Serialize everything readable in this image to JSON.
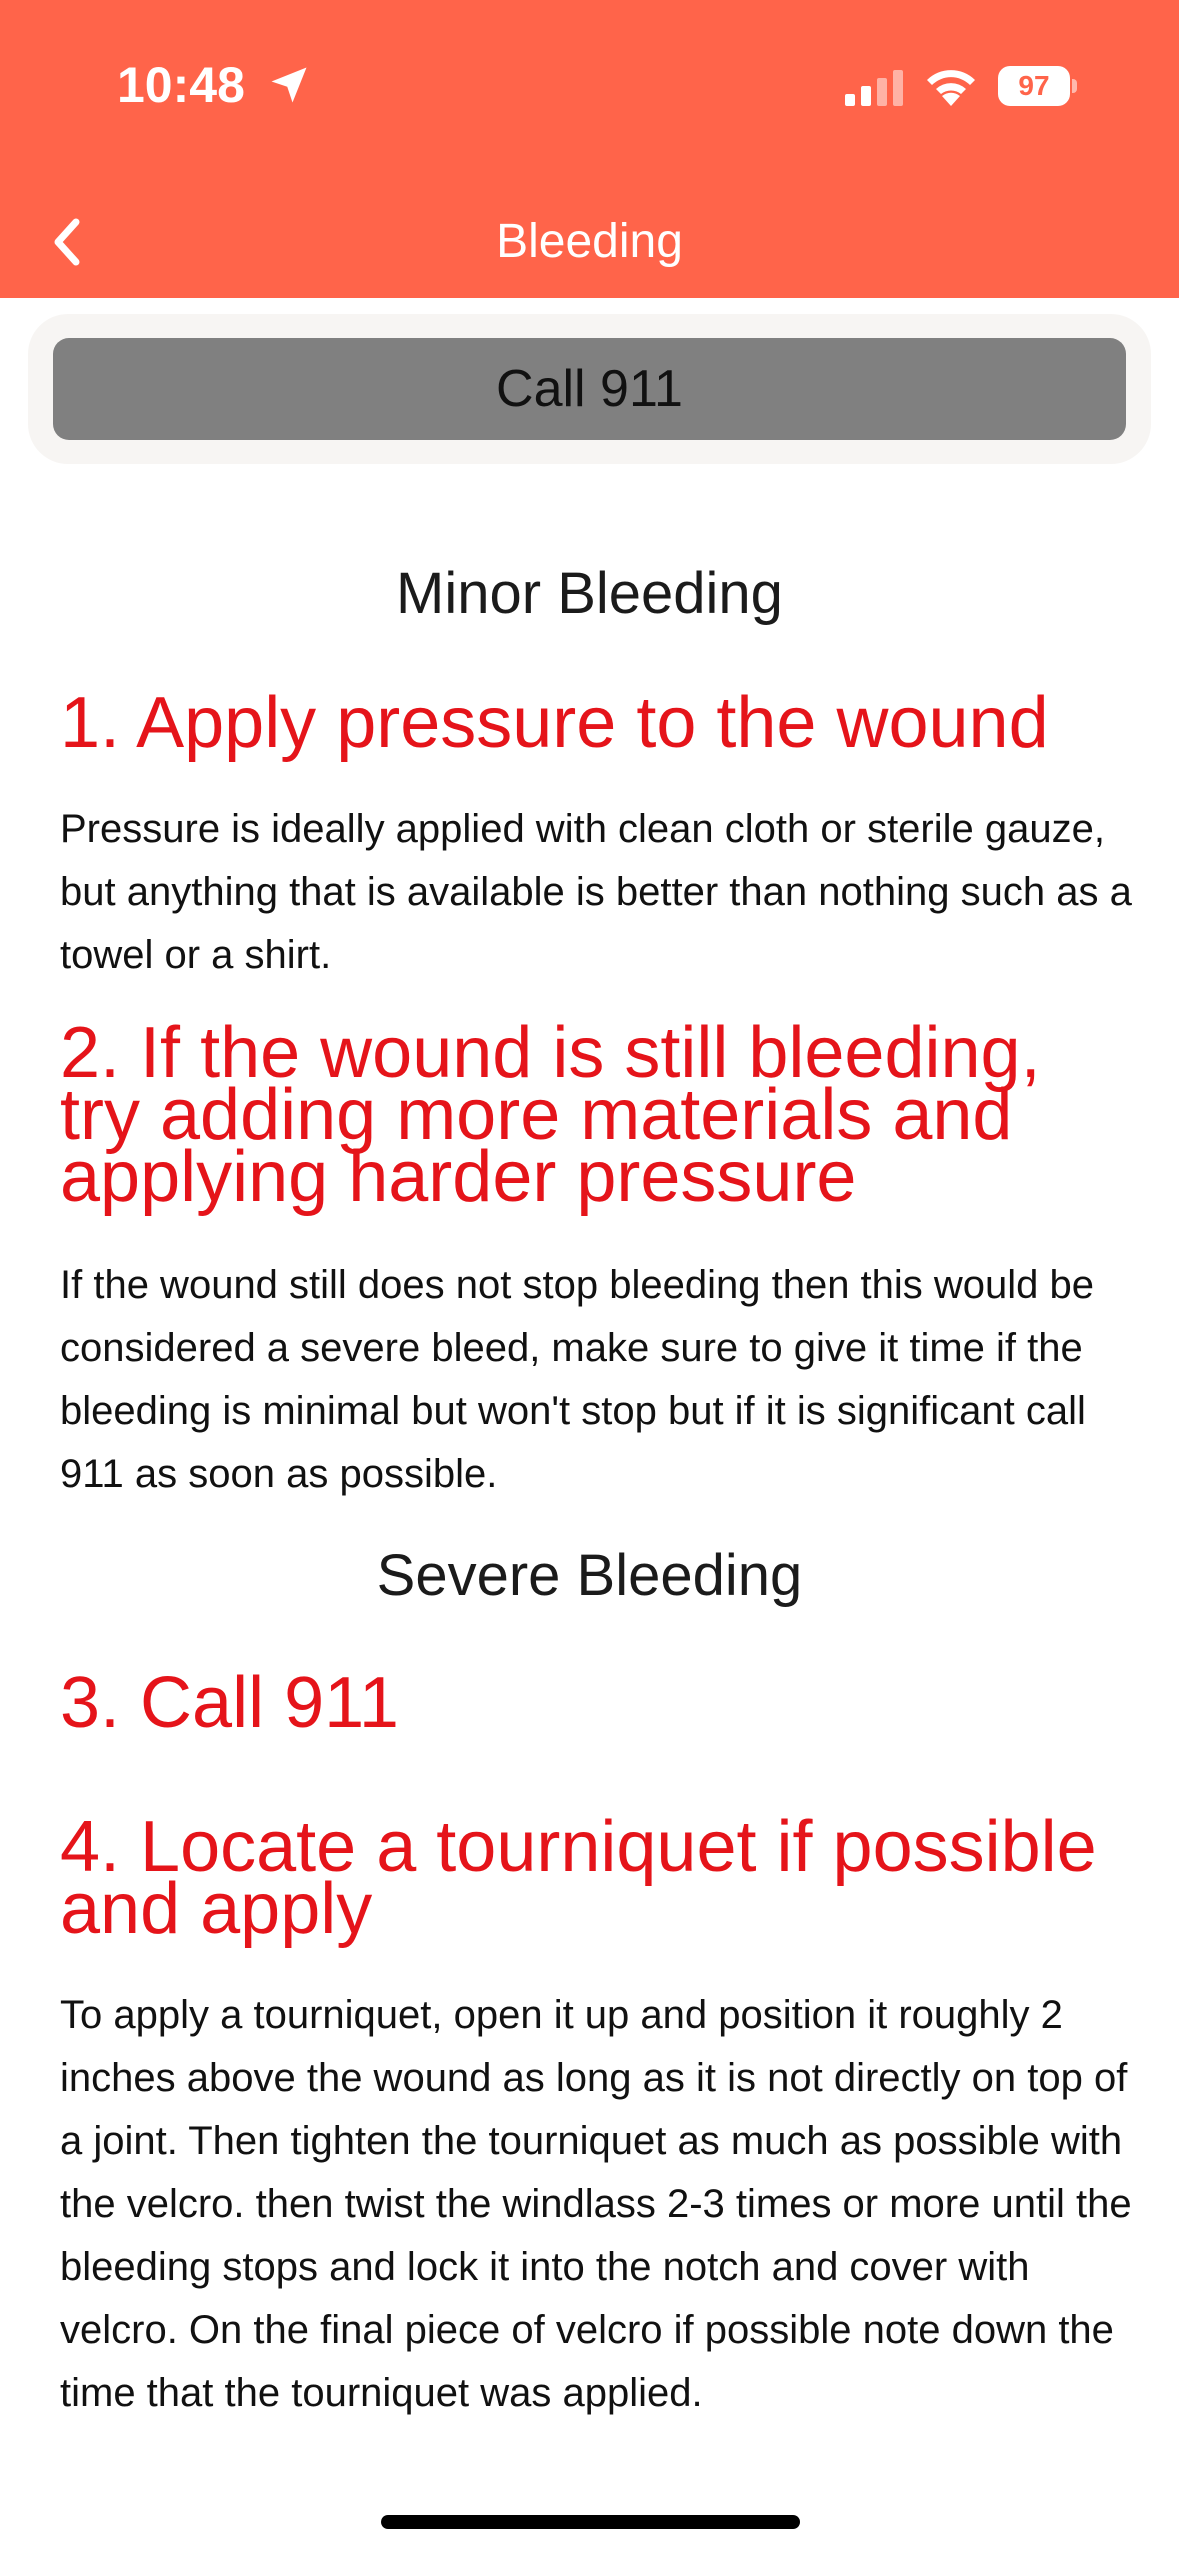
{
  "status_bar": {
    "time": "10:48",
    "battery": "97"
  },
  "nav": {
    "title": "Bleeding"
  },
  "call_button": {
    "label": "Call 911"
  },
  "sections": {
    "minor": "Minor Bleeding",
    "severe": "Severe Bleeding"
  },
  "steps": [
    {
      "title": "1. Apply pressure to the wound",
      "body": "Pressure is ideally applied with clean cloth or sterile gauze, but anything that is available is better than nothing such as a towel or a shirt."
    },
    {
      "title": "2. If the wound is still bleeding, try adding more materials and applying harder pressure",
      "body": "If the wound still does not stop bleeding then this would be considered a severe bleed, make sure to give it time if the bleeding is minimal but won't stop but if it is significant call 911 as soon as possible."
    },
    {
      "title": "3. Call 911",
      "body": ""
    },
    {
      "title": "4. Locate a tourniquet if possible and apply",
      "body": "To apply a tourniquet, open it up and position it roughly 2 inches above the wound as long as it is not directly on top of a joint. Then tighten the tourniquet as much as possible with the velcro. then twist the windlass 2-3 times or more until the bleeding stops and lock it into the notch and cover with velcro. On the final piece of velcro if possible note down the time that the tourniquet was applied."
    }
  ],
  "colors": {
    "header": "#FF644A",
    "step_title": "#E5141A",
    "call_button": "#808080"
  },
  "icons": [
    "location-arrow-icon",
    "cellular-signal-icon",
    "wifi-icon",
    "battery-icon",
    "chevron-left-icon"
  ]
}
